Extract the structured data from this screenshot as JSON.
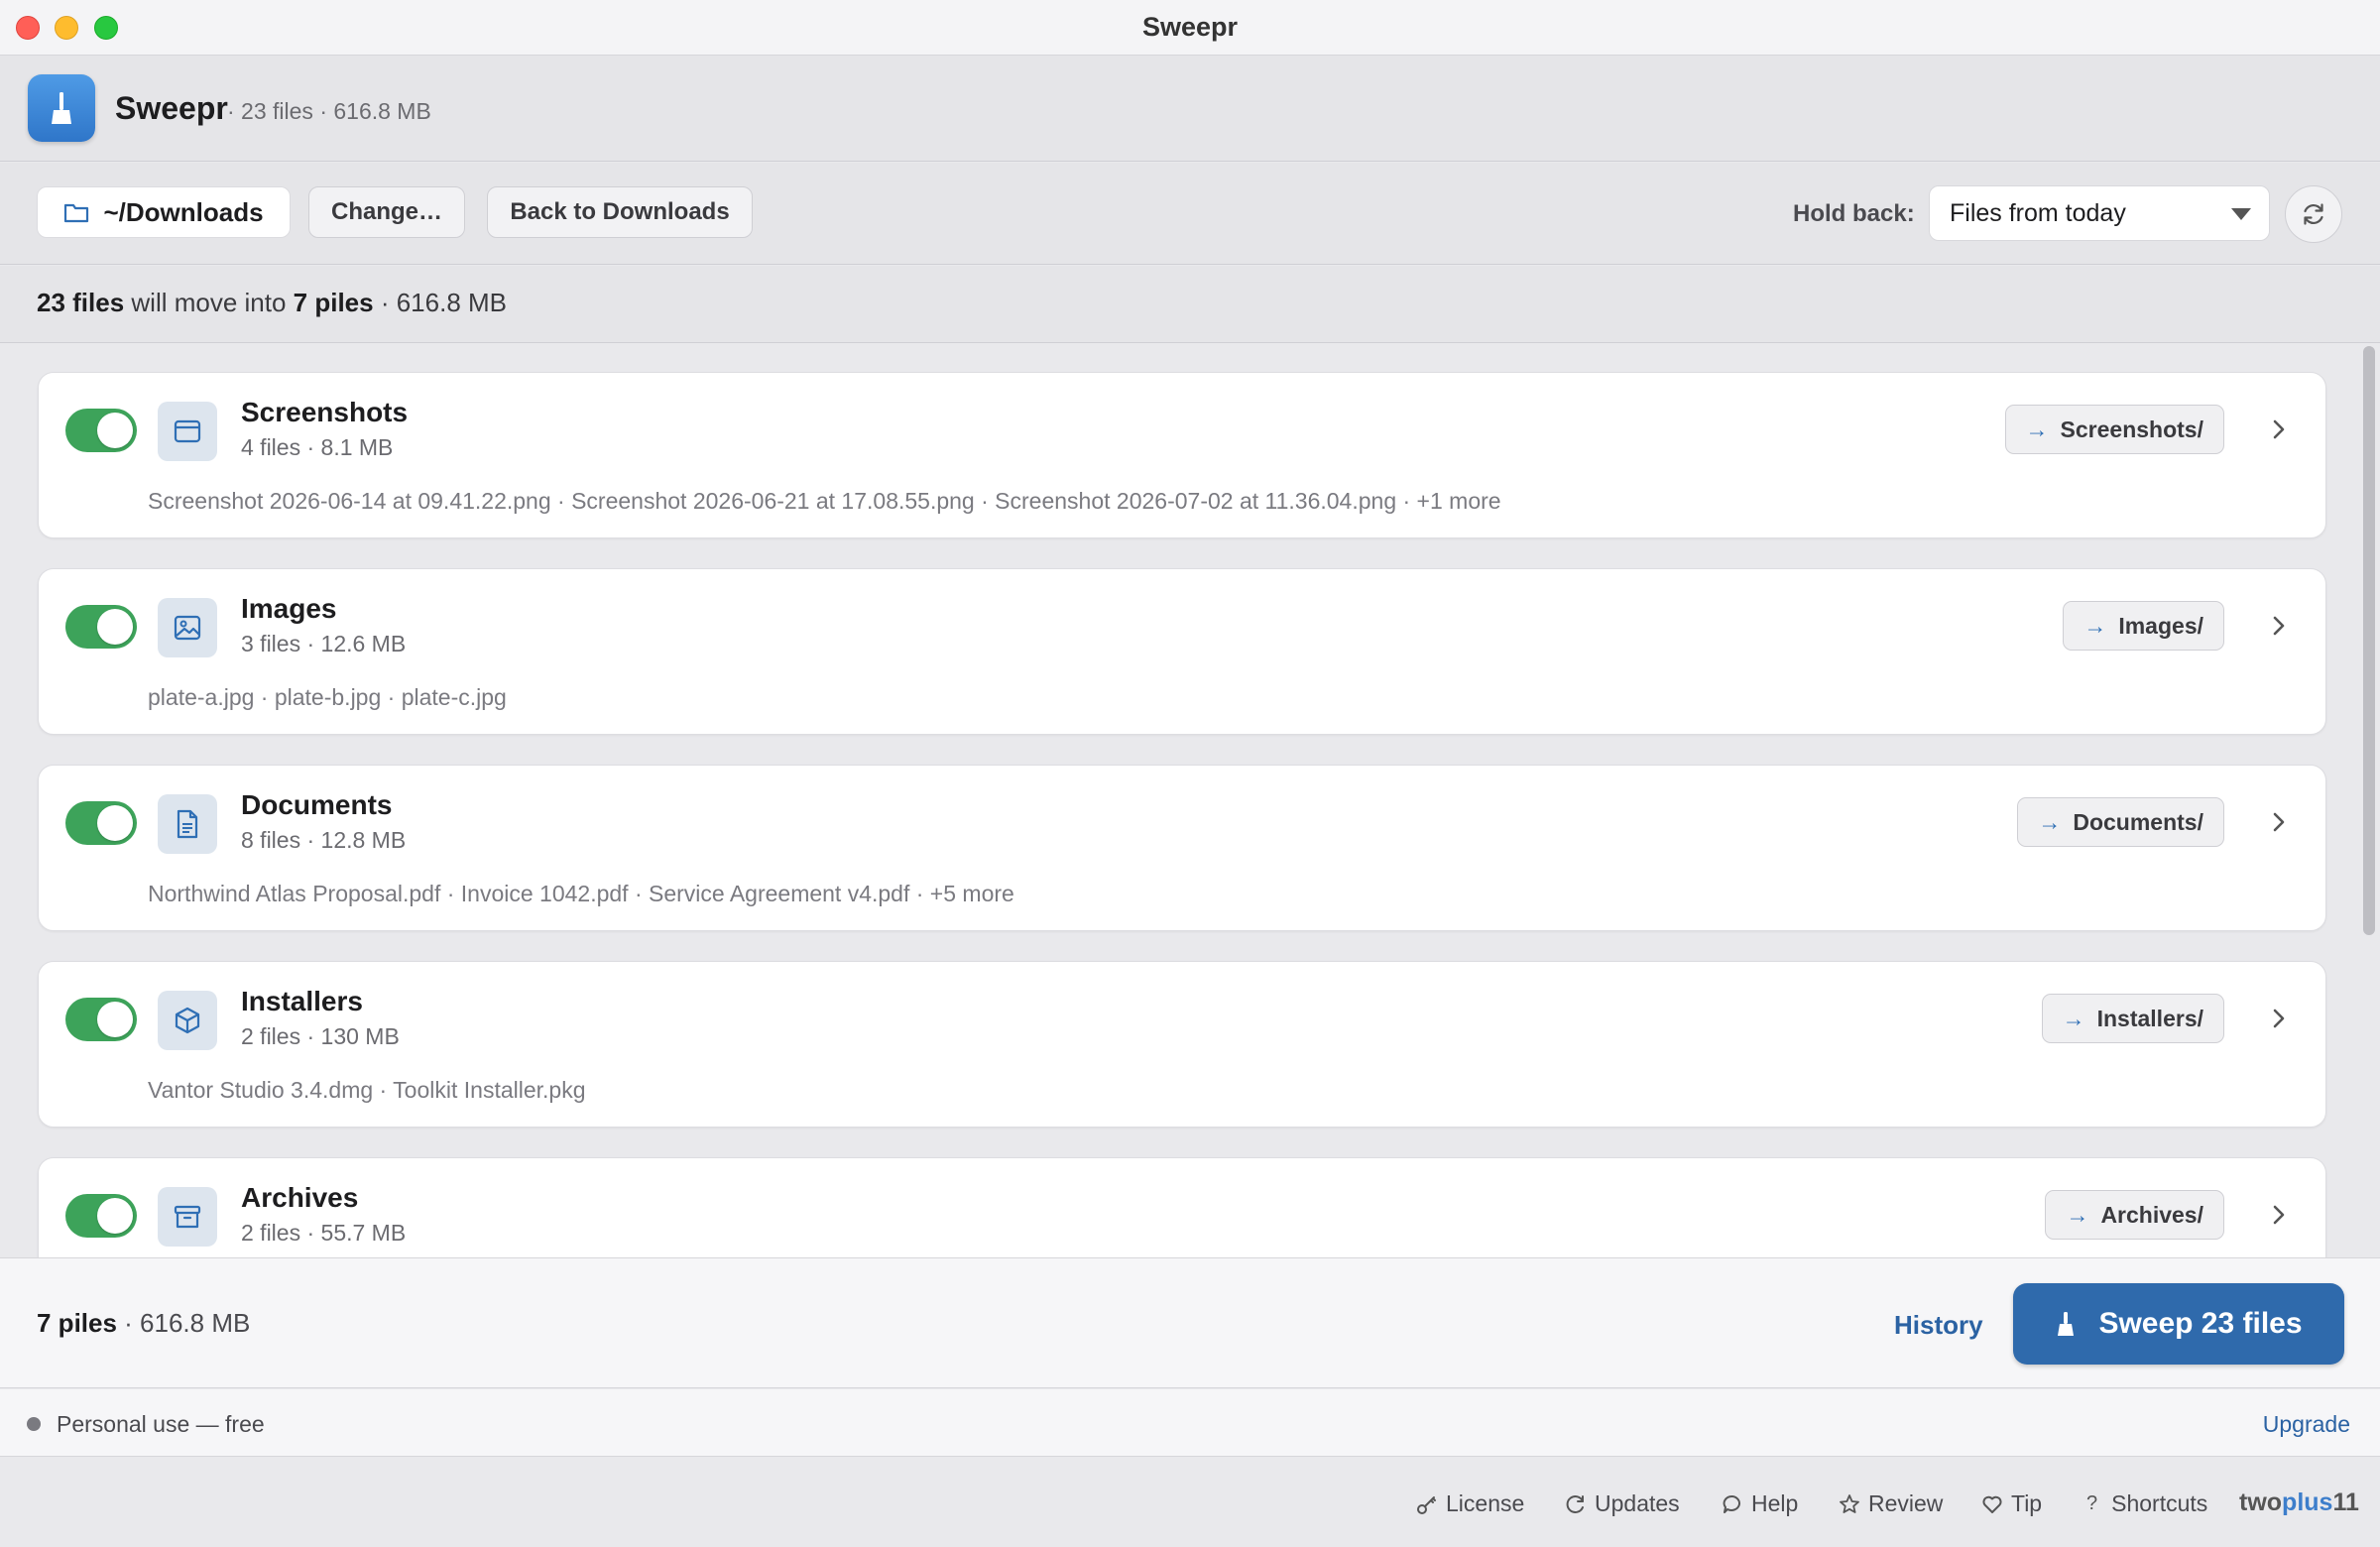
{
  "window": {
    "title": "Sweepr"
  },
  "app": {
    "name": "Sweepr",
    "meta": "· 23 files · 616.8 MB"
  },
  "toolbar": {
    "folder_label": "~/Downloads",
    "change_label": "Change…",
    "back_label": "Back to Downloads",
    "holdback_label": "Hold back:",
    "holdback_value": "Files from today"
  },
  "summary": {
    "files": "23 files",
    "middle": " will move into ",
    "piles": "7 piles",
    "size": " · 616.8 MB"
  },
  "categories": [
    {
      "name": "Screenshots",
      "meta": "4 files · 8.1 MB",
      "files": "Screenshot 2026-06-14 at 09.41.22.png · Screenshot 2026-06-21 at 17.08.55.png · Screenshot 2026-07-02 at 11.36.04.png · +1 more",
      "dest": "Screenshots/",
      "icon": "window-icon",
      "enabled": true
    },
    {
      "name": "Images",
      "meta": "3 files · 12.6 MB",
      "files": "plate-a.jpg · plate-b.jpg · plate-c.jpg",
      "dest": "Images/",
      "icon": "image-icon",
      "enabled": true
    },
    {
      "name": "Documents",
      "meta": "8 files · 12.8 MB",
      "files": "Northwind Atlas Proposal.pdf · Invoice 1042.pdf · Service Agreement v4.pdf · +5 more",
      "dest": "Documents/",
      "icon": "document-icon",
      "enabled": true
    },
    {
      "name": "Installers",
      "meta": "2 files · 130 MB",
      "files": "Vantor Studio 3.4.dmg · Toolkit Installer.pkg",
      "dest": "Installers/",
      "icon": "package-icon",
      "enabled": true
    },
    {
      "name": "Archives",
      "meta": "2 files · 55.7 MB",
      "files": "",
      "dest": "Archives/",
      "icon": "archive-icon",
      "enabled": true
    }
  ],
  "footer": {
    "piles": "7 piles",
    "size": " · 616.8 MB",
    "history_label": "History",
    "sweep_label": "Sweep 23 files"
  },
  "license": {
    "text": "Personal use — free",
    "upgrade_label": "Upgrade"
  },
  "links": {
    "license": "License",
    "updates": "Updates",
    "help": "Help",
    "review": "Review",
    "tip": "Tip",
    "shortcuts": "Shortcuts",
    "brand_a": "two",
    "brand_b": "plus",
    "brand_c": "11"
  },
  "colors": {
    "accent": "#2f6aac",
    "toggle_on": "#3da35a",
    "link": "#2b62a3"
  }
}
